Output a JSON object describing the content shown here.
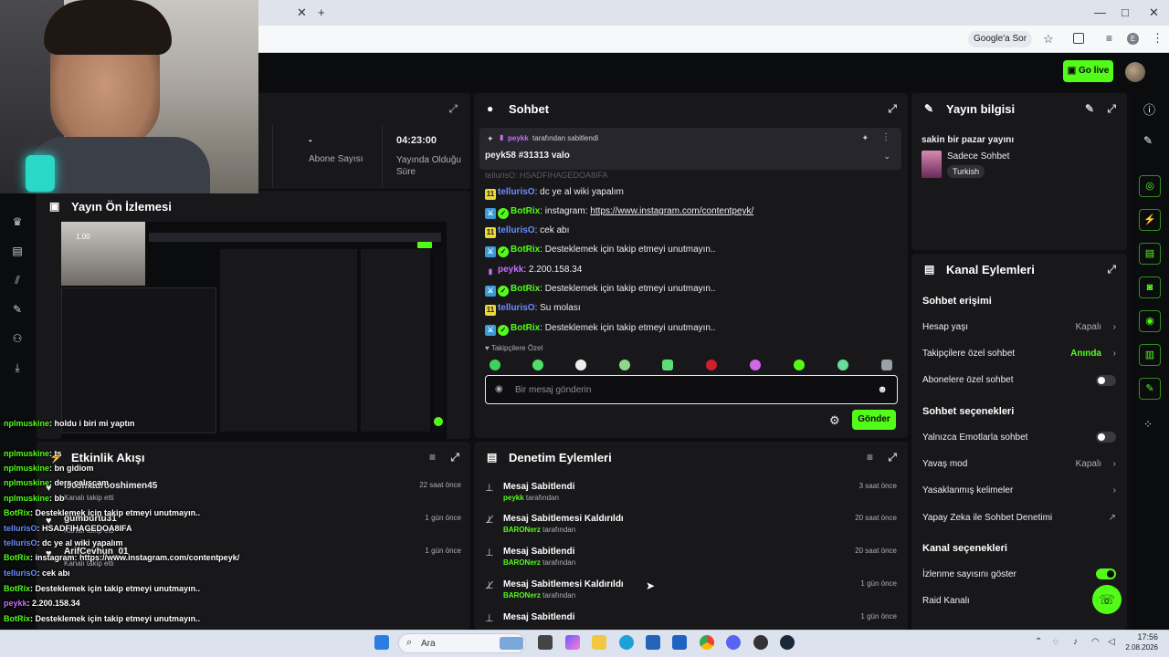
{
  "browser": {
    "ask_google": "Google'a Sor"
  },
  "header": {
    "go_live": "Go live"
  },
  "stats": {
    "subscribers_value": "-",
    "subscribers_label": "Abone Sayısı",
    "uptime_value": "04:23:00",
    "uptime_label": "Yayında Olduğu Süre"
  },
  "preview": {
    "title": "Yayın Ön İzlemesi"
  },
  "activity": {
    "title": "Etkinlik Akışı",
    "items": [
      {
        "user": "l905maurooshimen45",
        "action": "Kanalı takip etti",
        "time": "22 saat önce"
      },
      {
        "user": "gumburtu31",
        "action": "Kanalı takip etti",
        "time": "1 gün önce"
      },
      {
        "user": "ArifCevhun_01",
        "action": "Kanalı takip etti",
        "time": "1 gün önce"
      }
    ]
  },
  "chat": {
    "title": "Sohbet",
    "pinned_by_user": "peykk",
    "pinned_by_text": "tarafından sabitlendi",
    "pinned_message": "peyk58 #31313 valo",
    "partial_line": "tellurisO: HSADFIHAGEDOA8IFA",
    "messages": [
      {
        "user": "tellurisO",
        "text": ": dc ye al wiki yapalım"
      },
      {
        "user": "BotRix",
        "text": ": instagram: ",
        "link": "https://www.instagram.com/contentpeyk/"
      },
      {
        "user": "tellurisO",
        "text": ": cek abı"
      },
      {
        "user": "BotRix",
        "text": ": Desteklemek için takip etmeyi unutmayın.."
      },
      {
        "user": "peykk",
        "text": ": 2.200.158.34"
      },
      {
        "user": "BotRix",
        "text": ": Desteklemek için takip etmeyi unutmayın.."
      },
      {
        "user": "tellurisO",
        "text": ": Su molası"
      },
      {
        "user": "BotRix",
        "text": ": Desteklemek için takip etmeyi unutmayın.."
      }
    ],
    "followers_only": "Takipçilere Özel",
    "input_placeholder": "Bir mesaj gönderin",
    "send_label": "Gönder"
  },
  "moderation": {
    "title": "Denetim Eylemleri",
    "items": [
      {
        "title": "Mesaj Sabitlendi",
        "user": "peykk",
        "suffix": "tarafından",
        "time": "3 saat önce",
        "icon": "pin-icon"
      },
      {
        "title": "Mesaj Sabitlemesi Kaldırıldı",
        "user": "BARONerz",
        "suffix": "tarafından",
        "time": "20 saat önce",
        "icon": "unpin-icon"
      },
      {
        "title": "Mesaj Sabitlendi",
        "user": "BARONerz",
        "suffix": "tarafından",
        "time": "20 saat önce",
        "icon": "pin-icon"
      },
      {
        "title": "Mesaj Sabitlemesi Kaldırıldı",
        "user": "BARONerz",
        "suffix": "tarafından",
        "time": "1 gün önce",
        "icon": "unpin-icon"
      },
      {
        "title": "Mesaj Sabitlendi",
        "user": "",
        "suffix": "",
        "time": "1 gün önce",
        "icon": "pin-icon"
      }
    ]
  },
  "stream_info": {
    "title": "Yayın bilgisi",
    "stream_title": "sakin bir pazar yayını",
    "category": "Sadece Sohbet",
    "language": "Turkish"
  },
  "channel_actions": {
    "title": "Kanal Eylemleri",
    "chat_access": "Sohbet erişimi",
    "account_age": "Hesap yaşı",
    "account_age_value": "Kapalı",
    "followers_chat": "Takipçilere özel sohbet",
    "followers_chat_value": "Anında",
    "subscribers_chat": "Abonelere özel sohbet",
    "chat_options": "Sohbet seçenekleri",
    "emote_only": "Yalnızca Emotlarla sohbet",
    "slow_mode": "Yavaş mod",
    "slow_mode_value": "Kapalı",
    "banned_words": "Yasaklanmış kelimeler",
    "ai_moderation": "Yapay Zeka ile Sohbet Denetimi",
    "channel_options": "Kanal seçenekleri",
    "show_viewers": "İzlenme sayısını göster",
    "raid_channel": "Raid Kanalı",
    "subscribers_chat_on": false,
    "emote_only_on": false,
    "show_viewers_on": true
  },
  "overlay_chat": [
    {
      "user": "nplmuskine",
      "text": ": holdu i biri mi yaptın",
      "color": "#53fc18"
    },
    {
      "user": "nplmuskine",
      "text": ": ts",
      "color": "#53fc18"
    },
    {
      "user": "nplmuskine",
      "text": ": bn gidiom",
      "color": "#53fc18"
    },
    {
      "user": "nplmuskine",
      "text": ": ders çalışcam",
      "color": "#53fc18"
    },
    {
      "user": "nplmuskine",
      "text": ": bb",
      "color": "#53fc18"
    },
    {
      "user": "BotRix",
      "text": ": Desteklemek için takip etmeyi unutmayın..",
      "color": "#53fc18"
    },
    {
      "user": "tellurisO",
      "text": ": HSADFIHAGEDOA8IFA",
      "color": "#6b8cff"
    },
    {
      "user": "tellurisO",
      "text": ": dc ye al wiki yapalım",
      "color": "#6b8cff"
    },
    {
      "user": "BotRix",
      "text": ": instagram: https://www.instagram.com/contentpeyk/",
      "color": "#53fc18"
    },
    {
      "user": "tellurisO",
      "text": ": cek abı",
      "color": "#6b8cff"
    },
    {
      "user": "BotRix",
      "text": ": Desteklemek için takip etmeyi unutmayın..",
      "color": "#53fc18"
    },
    {
      "user": "peykk",
      "text": ": 2.200.158.34",
      "color": "#c86bff"
    },
    {
      "user": "BotRix",
      "text": ": Desteklemek için takip etmeyi unutmayın..",
      "color": "#53fc18"
    },
    {
      "user": "tellurisO",
      "text": ": Su molası",
      "color": "#6b8cff"
    },
    {
      "user": "BotRix",
      "text": ": Desteklemek için takip etmeyi unutmayın..",
      "color": "#53fc18"
    }
  ],
  "preview_overlay": {
    "zoom": "1.00"
  },
  "taskbar": {
    "search_label": "Ara",
    "time": "17:56",
    "date": "2.08.2026"
  },
  "colors": {
    "accent": "#53fc18",
    "panel": "#18181b",
    "background": "#0e0e10"
  }
}
